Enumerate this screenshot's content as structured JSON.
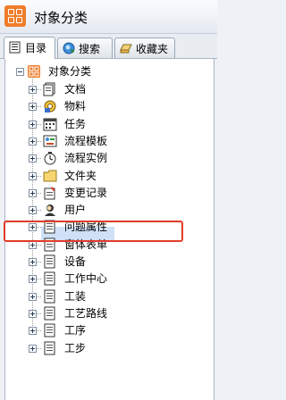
{
  "window": {
    "title": "对象分类"
  },
  "tabs": [
    {
      "label": "目录",
      "icon": "directory-icon",
      "active": true
    },
    {
      "label": "搜索",
      "icon": "search-icon",
      "active": false
    },
    {
      "label": "收藏夹",
      "icon": "favorites-icon",
      "active": false
    }
  ],
  "tree": {
    "root": {
      "label": "对象分类",
      "icon": "object-category-icon"
    },
    "items": [
      {
        "label": "文档",
        "icon": "document-stack-icon"
      },
      {
        "label": "物料",
        "icon": "material-gear-icon"
      },
      {
        "label": "任务",
        "icon": "task-calendar-icon"
      },
      {
        "label": "流程模板",
        "icon": "flow-template-icon"
      },
      {
        "label": "流程实例",
        "icon": "flow-instance-icon"
      },
      {
        "label": "文件夹",
        "icon": "folder-icon"
      },
      {
        "label": "变更记录",
        "icon": "change-record-icon"
      },
      {
        "label": "用户",
        "icon": "user-icon"
      },
      {
        "label": "问题属性",
        "icon": "document-icon"
      },
      {
        "label": "窗体表单",
        "icon": "document-icon",
        "selected": true
      },
      {
        "label": "设备",
        "icon": "document-icon"
      },
      {
        "label": "工作中心",
        "icon": "document-icon"
      },
      {
        "label": "工装",
        "icon": "document-icon"
      },
      {
        "label": "工艺路线",
        "icon": "document-icon"
      },
      {
        "label": "工序",
        "icon": "document-icon"
      },
      {
        "label": "工步",
        "icon": "document-icon"
      }
    ]
  },
  "colors": {
    "highlight_border": "#e23b2a",
    "selection_bg": "#cfe0f7",
    "accent": "#ef7d2b"
  }
}
